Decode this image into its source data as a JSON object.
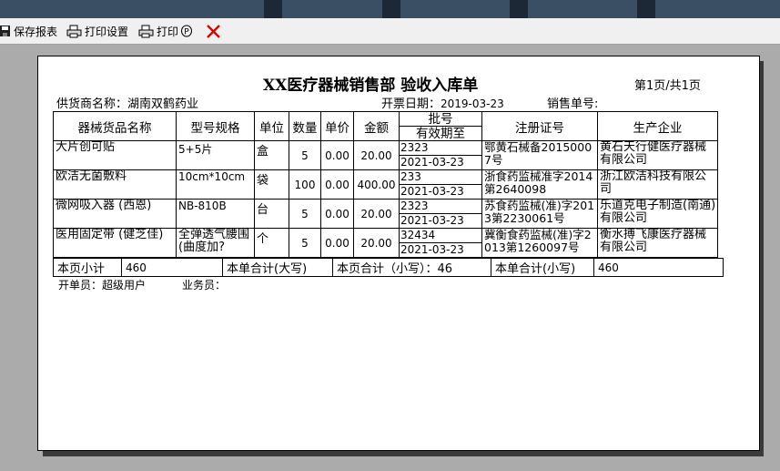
{
  "toolbar": {
    "save_label": "保存报表",
    "print_setup_label": "打印设置",
    "print_label": "打印",
    "print_shortcut": "P"
  },
  "report": {
    "title": "XX医疗器械销售部  验收入库单",
    "page_info": "第1页/共1页",
    "supplier_label": "供货商名称：",
    "supplier": "湖南双鹤药业",
    "date_label": "开票日期：",
    "date": "2019-03-23",
    "order_no_label": "销售单号:",
    "order_no": ""
  },
  "table": {
    "headers": {
      "name": "器械货品名称",
      "model": "型号规格",
      "unit": "单位",
      "qty": "数量",
      "price": "单价",
      "amount": "金额",
      "batch": "批号",
      "expiry": "有效期至",
      "reg_no": "注册证号",
      "manufacturer": "生产企业"
    },
    "rows": [
      {
        "name": "大片创可贴",
        "model": "5+5片",
        "unit": "盒",
        "qty": "5",
        "price": "0.00",
        "amount": "20.00",
        "batch": "2323",
        "expiry": "2021-03-23",
        "reg_no": "鄂黄石械备20150007号",
        "manufacturer": "黄石天行健医疗器械有限公司"
      },
      {
        "name": "欧洁无菌敷料",
        "model": "10cm*10cm",
        "unit": "袋",
        "qty": "100",
        "price": "0.00",
        "amount": "400.00",
        "batch": "233",
        "expiry": "2021-03-23",
        "reg_no": "浙食药监械准字2014第2640098",
        "manufacturer": "浙江欧洁科技有限公司"
      },
      {
        "name": "微网吸入器 (西恩)",
        "model": "NB-810B",
        "unit": "台",
        "qty": "5",
        "price": "0.00",
        "amount": "20.00",
        "batch": "2323",
        "expiry": "2021-03-23",
        "reg_no": "苏食药监械(准)字2013第2230061号",
        "manufacturer": "乐道克电子制造(南通)有限公司"
      },
      {
        "name": "医用固定带 (健芝佳)",
        "model": "全弹透气腰围(曲度加?",
        "unit": "个",
        "qty": "5",
        "price": "0.00",
        "amount": "20.00",
        "batch": "32434",
        "expiry": "2021-03-23",
        "reg_no": "冀衡食药监械(准)字2013第1260097号",
        "manufacturer": "衡水搏飞康医疗器械有限公司"
      }
    ]
  },
  "totals": {
    "page_subtotal_label": "本页小计",
    "page_subtotal": "460",
    "order_total_upper_label": "本单合计(大写)",
    "page_total_lower_text": "本页合计（小写）：46",
    "order_total_lower_label": "本单合计(小写)",
    "order_total_lower": "460"
  },
  "footer": {
    "operator_label": "开单员：",
    "operator": "超级用户",
    "salesman_label": "业务员：",
    "salesman": ""
  }
}
